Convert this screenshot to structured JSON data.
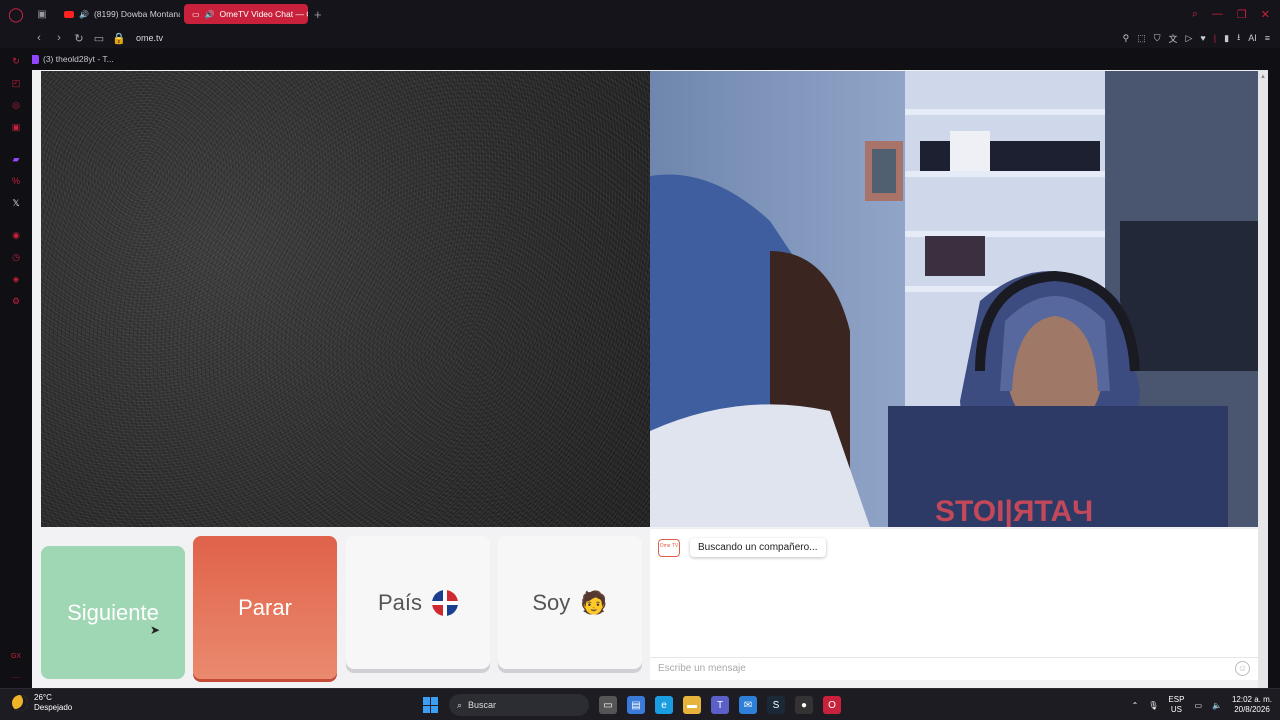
{
  "browser": {
    "tabs": [
      {
        "title": "(8199) Dowba Montana",
        "active": false
      },
      {
        "title": "OmeTV Video Chat — O",
        "active": true
      }
    ],
    "url": "ome.tv",
    "bookmark": "(3) theold28yt - T...",
    "addr_right_ai": "AI"
  },
  "sidebar": {
    "icons": [
      "history-icon",
      "bag-icon",
      "instagram-icon",
      "messenger-icon",
      "twitch-icon",
      "percent-icon",
      "x-icon",
      "clock-circle-icon",
      "history2-icon",
      "bulb-icon",
      "settings-icon"
    ],
    "gx_label": "GX",
    "more_label": "···"
  },
  "controls": {
    "next_label": "Siguiente",
    "stop_label": "Parar",
    "country_label": "País",
    "country_flag": "dominican-republic-flag",
    "gender_label": "Soy",
    "gender_emoji": "🧑"
  },
  "chat": {
    "logo_label": "Ome TV",
    "status_message": "Buscando un compañero...",
    "input_placeholder": "Escribe un mensaje"
  },
  "taskbar": {
    "temperature": "26°C",
    "weather": "Despejado",
    "search_label": "Buscar",
    "lang_top": "ESP",
    "lang_bottom": "US",
    "time": "12:02 a. m.",
    "date": "20/8/2026"
  },
  "colors": {
    "opera_red": "#c9213c",
    "next_green": "#9fd6b4",
    "stop_orange": "#e0624a"
  }
}
